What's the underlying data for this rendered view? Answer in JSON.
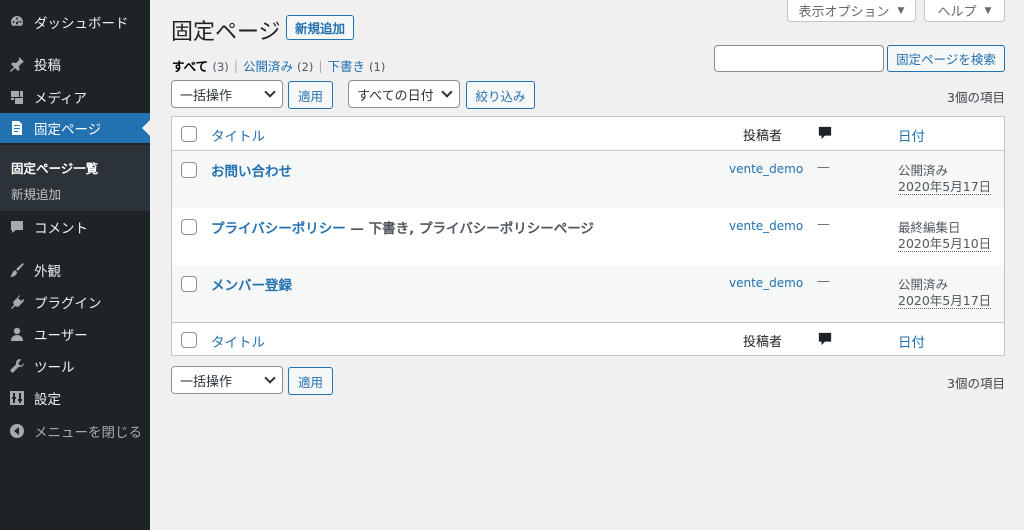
{
  "sidebar": {
    "items": [
      {
        "label": "ダッシュボード",
        "icon": "dashboard-icon"
      },
      {
        "label": "投稿",
        "icon": "pin-icon"
      },
      {
        "label": "メディア",
        "icon": "media-icon"
      },
      {
        "label": "固定ページ",
        "icon": "page-icon"
      },
      {
        "label": "コメント",
        "icon": "comment-icon"
      },
      {
        "label": "外観",
        "icon": "brush-icon"
      },
      {
        "label": "プラグイン",
        "icon": "plugin-icon"
      },
      {
        "label": "ユーザー",
        "icon": "user-icon"
      },
      {
        "label": "ツール",
        "icon": "wrench-icon"
      },
      {
        "label": "設定",
        "icon": "settings-icon"
      },
      {
        "label": "メニューを閉じる",
        "icon": "collapse-icon"
      }
    ],
    "submenu": [
      "固定ページ一覧",
      "新規追加"
    ]
  },
  "screen_tabs": {
    "options": "表示オプション",
    "help": "ヘルプ"
  },
  "header": {
    "title": "固定ページ",
    "add_new": "新規追加"
  },
  "filters": [
    {
      "label": "すべて",
      "count": "(3)"
    },
    {
      "label": "公開済み",
      "count": "(2)"
    },
    {
      "label": "下書き",
      "count": "(1)"
    }
  ],
  "filter_separator": "|",
  "search": {
    "value": "",
    "button": "固定ページを検索"
  },
  "top_nav": {
    "bulk_action": "一括操作",
    "apply": "適用",
    "date_filter": "すべての日付",
    "filter_button": "絞り込み",
    "items_count": "3個の項目"
  },
  "bottom_nav": {
    "bulk_action": "一括操作",
    "apply": "適用",
    "items_count": "3個の項目"
  },
  "table": {
    "columns": {
      "title": "タイトル",
      "author": "投稿者",
      "date": "日付"
    },
    "rows": [
      {
        "title": "お問い合わせ",
        "state": "",
        "author": "vente_demo",
        "comments": "—",
        "date_status": "公開済み",
        "date": "2020年5月17日"
      },
      {
        "title": "プライバシーポリシー",
        "state": " — 下書き, プライバシーポリシーページ",
        "author": "vente_demo",
        "comments": "—",
        "date_status": "最終編集日",
        "date": "2020年5月10日"
      },
      {
        "title": "メンバー登録",
        "state": "",
        "author": "vente_demo",
        "comments": "—",
        "date_status": "公開済み",
        "date": "2020年5月17日"
      }
    ]
  },
  "colors": {
    "sidebar": "#1d2327",
    "accent": "#2271b1",
    "background": "#f0f0f1"
  }
}
